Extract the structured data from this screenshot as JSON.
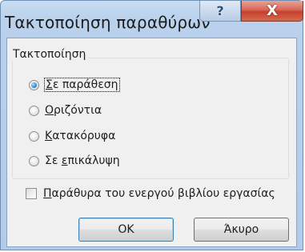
{
  "window": {
    "title": "Τακτοποίηση παραθύρων",
    "help_glyph": "?",
    "close_glyph": "X"
  },
  "arrange_group": {
    "legend": "Τακτοποίηση",
    "options": [
      {
        "mnemonic": "Σ",
        "rest": "ε παράθεση",
        "selected": true
      },
      {
        "mnemonic": "Ο",
        "rest": "ριζόντια",
        "selected": false
      },
      {
        "mnemonic": "Κ",
        "rest": "ατακόρυφα",
        "selected": false
      },
      {
        "prefix": "Σε ",
        "mnemonic": "ε",
        "rest": "πικάλυψη",
        "selected": false
      }
    ]
  },
  "active_workbook_checkbox": {
    "mnemonic": "Π",
    "rest": "αράθυρα του ενεργού βιβλίου εργασίας",
    "checked": false
  },
  "buttons": {
    "ok": "ΟΚ",
    "cancel": "Άκυρο"
  },
  "colors": {
    "titlebar": "#b9d1ec",
    "close_button": "#c6402f",
    "dialog_background": "#f0f0f0",
    "selected_radio": "#3d8fd1"
  }
}
